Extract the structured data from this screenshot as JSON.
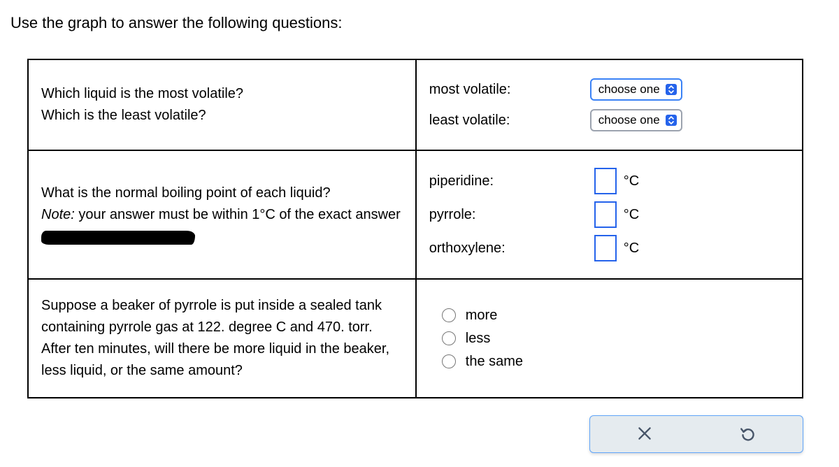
{
  "page": {
    "title": "Use the graph to answer the following questions:"
  },
  "rows": {
    "r1": {
      "question_l1": "Which liquid is the most volatile?",
      "question_l2": "Which is the least volatile?",
      "label_most": "most volatile:",
      "label_least": "least volatile:",
      "select_placeholder": "choose one"
    },
    "r2": {
      "question_l1": "What is the normal boiling point of each liquid?",
      "note_prefix": "Note:",
      "note_rest": " your answer must be within 1°C of the exact answer",
      "label_piperidine": "piperidine:",
      "label_pyrrole": "pyrrole:",
      "label_orthoxylene": "orthoxylene:",
      "unit": "°C"
    },
    "r3": {
      "question": "Suppose a beaker of pyrrole is put inside a sealed tank containing pyrrole gas at 122. degree C and 470. torr. After ten minutes, will there be more liquid in the beaker, less liquid, or the same amount?",
      "opt_more": "more",
      "opt_less": "less",
      "opt_same": "the same"
    }
  }
}
